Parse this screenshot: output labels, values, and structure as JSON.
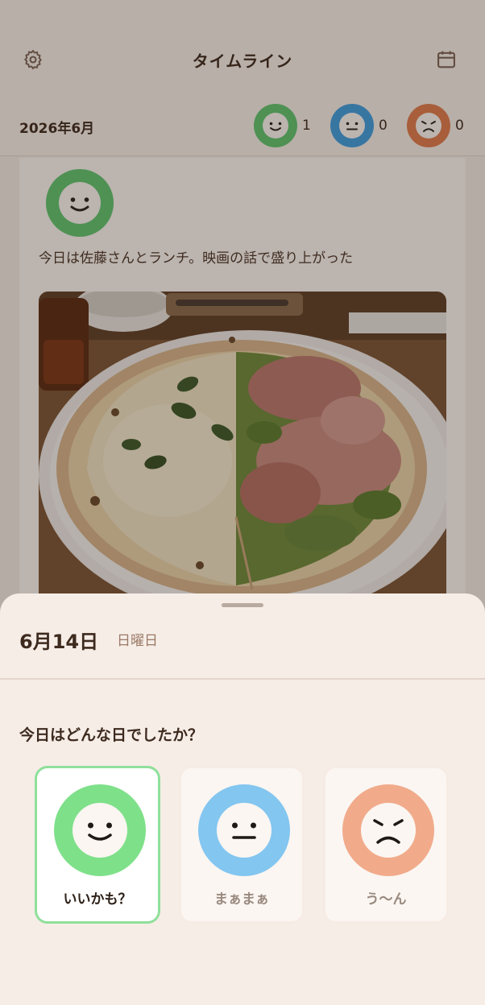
{
  "header": {
    "title": "タイムライン",
    "settings_icon": "gear-icon",
    "calendar_icon": "calendar-icon"
  },
  "summary": {
    "month": "2026年6月",
    "stats": [
      {
        "mood": "good",
        "count": "1",
        "color": "#5fc46f"
      },
      {
        "mood": "neutral",
        "count": "0",
        "color": "#3f9ee0"
      },
      {
        "mood": "bad",
        "count": "0",
        "color": "#e07c4d"
      }
    ]
  },
  "entry": {
    "mood": "good",
    "note": "今日は佐藤さんとランチ。映画の話で盛り上がった",
    "photo": "pizza-photo"
  },
  "sheet": {
    "date": "6月14日",
    "weekday": "日曜日",
    "question": "今日はどんな日でしたか？",
    "options": [
      {
        "label": "いいかも？",
        "selected": true,
        "color": "#7fe08a"
      },
      {
        "label": "まぁまぁ",
        "selected": false,
        "color": "#83c6f0"
      },
      {
        "label": "う～ん",
        "selected": false,
        "color": "#f1ab8b"
      }
    ]
  }
}
